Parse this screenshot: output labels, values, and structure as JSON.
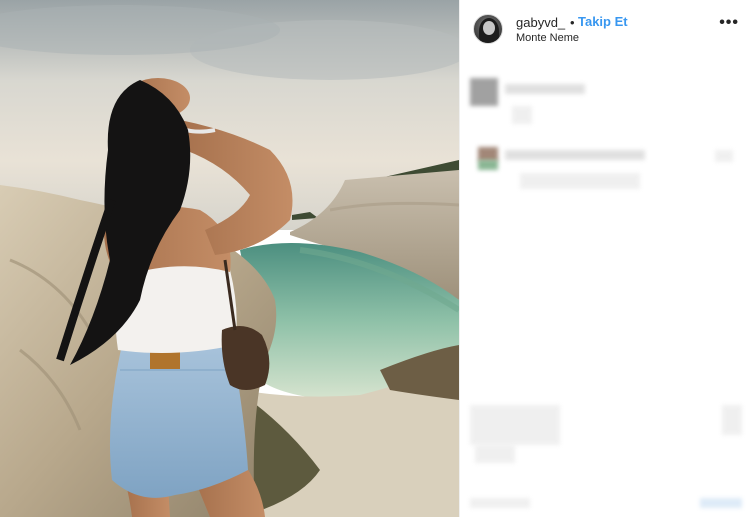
{
  "post": {
    "username": "gabyvd_",
    "separator": "•",
    "follow_label": "Takip Et",
    "location": "Monte Neme",
    "more_label": "•••"
  },
  "colors": {
    "link": "#3897f0",
    "text": "#262626",
    "border": "#efefef"
  },
  "icons": {
    "avatar": "profile-photo",
    "more": "more-options-icon"
  }
}
